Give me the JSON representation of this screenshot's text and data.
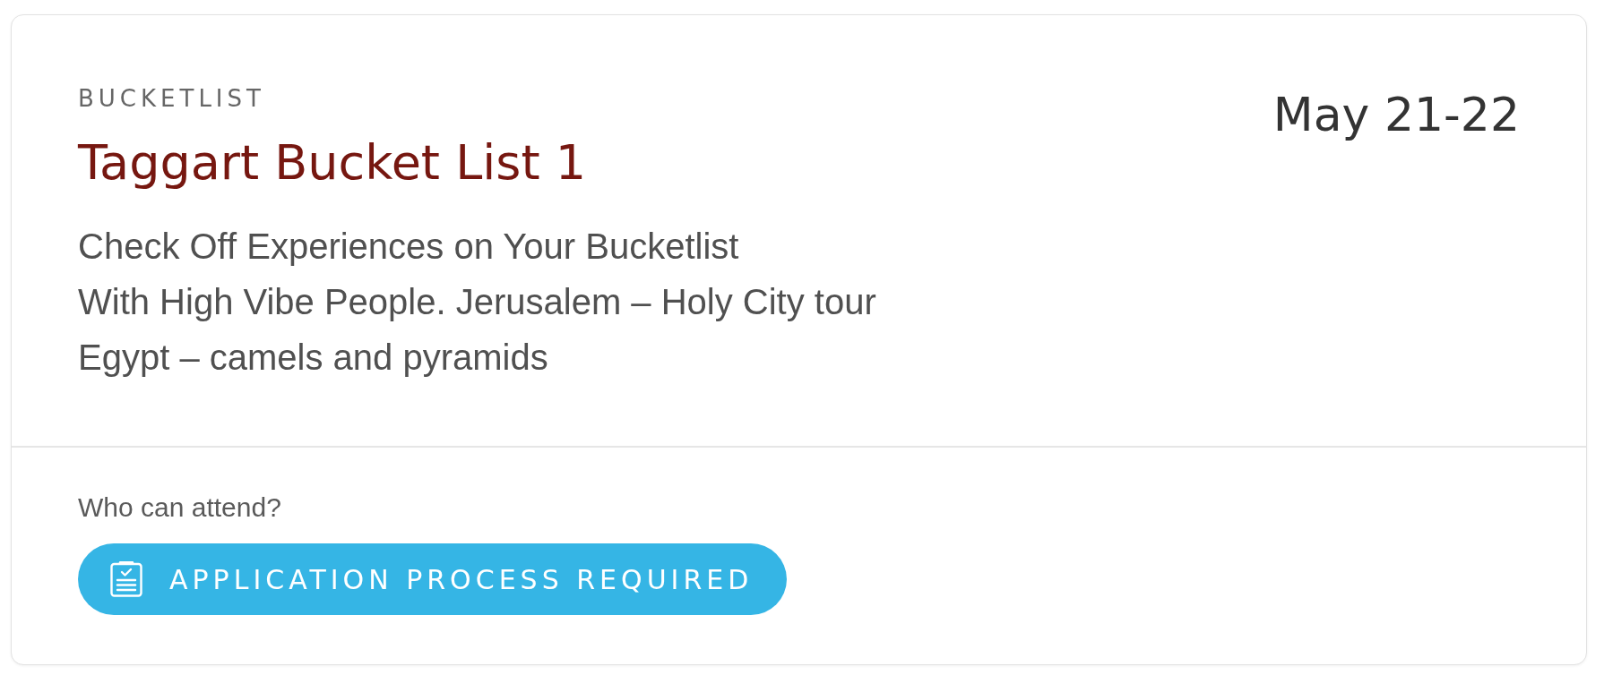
{
  "event": {
    "category": "BUCKETLIST",
    "title": "Taggart Bucket List 1",
    "date": "May 21-22",
    "description": [
      "Check Off Experiences on Your Bucketlist",
      "With High Vibe People. Jerusalem – Holy City tour",
      "Egypt – camels and pyramids"
    ]
  },
  "attendance": {
    "label": "Who can attend?",
    "badge": "APPLICATION PROCESS REQUIRED"
  }
}
